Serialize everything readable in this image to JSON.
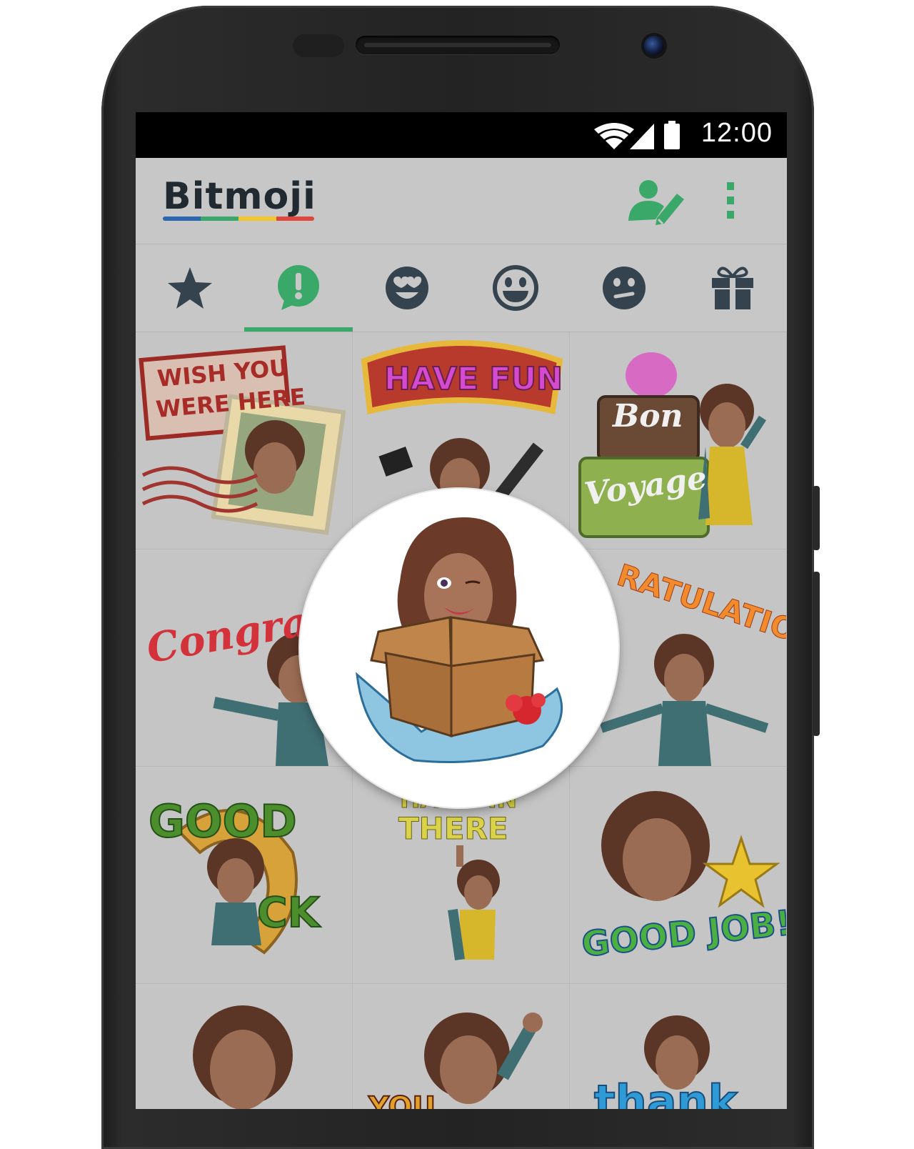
{
  "status": {
    "time": "12:00"
  },
  "app": {
    "title": "Bitmoji"
  },
  "icons": {
    "wifi": "wifi-icon",
    "signal": "signal-icon",
    "battery": "battery-icon",
    "avatar_edit": "avatar-edit-icon",
    "overflow": "overflow-menu-icon"
  },
  "tabs": [
    {
      "icon": "star-icon",
      "selected": false
    },
    {
      "icon": "speech-bubble-icon",
      "selected": true
    },
    {
      "icon": "heart-eyes-face-icon",
      "selected": false
    },
    {
      "icon": "grinning-face-icon",
      "selected": false
    },
    {
      "icon": "meh-face-icon",
      "selected": false
    },
    {
      "icon": "gift-icon",
      "selected": false
    }
  ],
  "stickers": {
    "s1": {
      "line1": "WISH YOU",
      "line2": "WERE HERE"
    },
    "s2": {
      "text": "HAVE FUN"
    },
    "s3": {
      "line1": "Bon",
      "line2": "Voyage"
    },
    "s4": {
      "text": "Congrats"
    },
    "s6": {
      "text": "RATULATIONS"
    },
    "s7": {
      "line1": "GOOD",
      "line2": "CK"
    },
    "s8": {
      "line1": "HANG IN",
      "line2": "THERE"
    },
    "s9": {
      "text": "GOOD JOB!"
    },
    "s11": {
      "text": "YOU"
    },
    "s12": {
      "text": "thank"
    }
  },
  "colors": {
    "accent": "#3aa869",
    "icon_dark": "#34434d",
    "logo_stripe": [
      "#2b67b0",
      "#3aa869",
      "#f3c72b",
      "#e0473c"
    ]
  }
}
